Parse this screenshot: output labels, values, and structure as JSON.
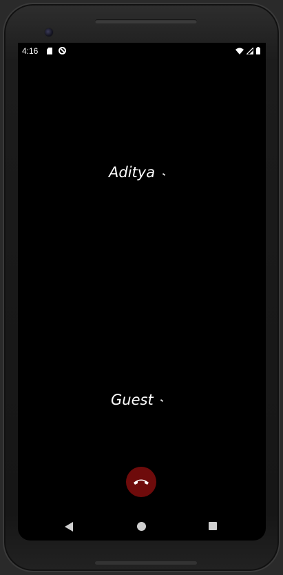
{
  "status_bar": {
    "time": "4:16",
    "icons": [
      "sd-card-icon",
      "dnd-icon",
      "wifi-icon",
      "signal-icon",
      "battery-icon"
    ]
  },
  "call": {
    "participants": [
      {
        "name": "Aditya",
        "mic_icon": "audio-indicator-icon"
      },
      {
        "name": "Guest",
        "mic_icon": "audio-indicator-icon"
      }
    ],
    "end_call_icon": "phone-hangup-icon",
    "end_call_color": "#6e0b0b"
  },
  "nav_bar": {
    "buttons": [
      "back-icon",
      "home-icon",
      "recents-icon"
    ]
  }
}
